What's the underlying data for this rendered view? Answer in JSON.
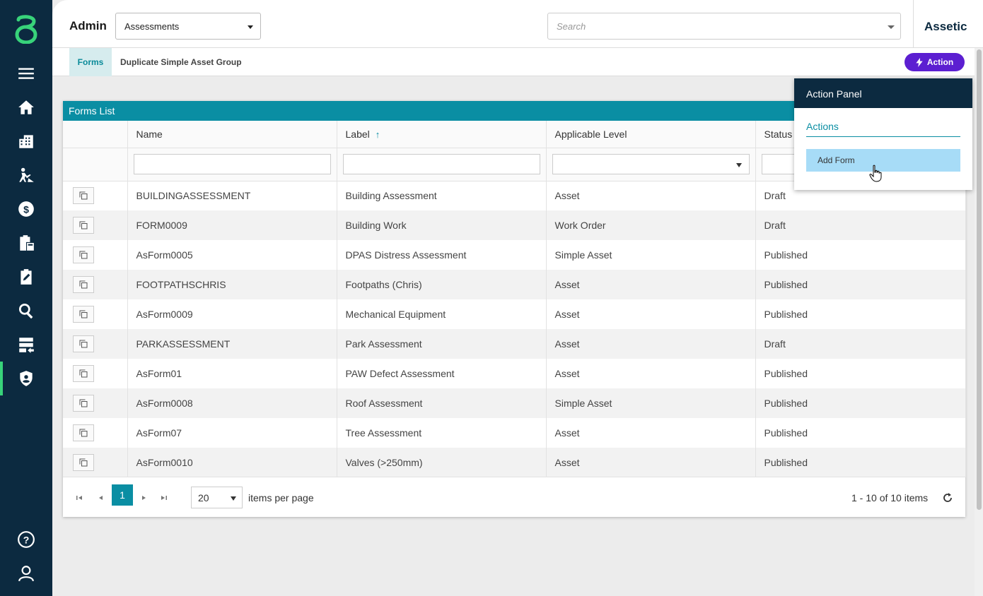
{
  "header": {
    "app_title": "Admin",
    "module_select": "Assessments",
    "search_placeholder": "Search",
    "brand": "Assetic"
  },
  "subbar": {
    "tab_forms": "Forms",
    "crumb": "Duplicate Simple Asset Group",
    "action_label": "Action"
  },
  "sidebar": {
    "icons": [
      "logo-icon",
      "menu-icon",
      "home-icon",
      "buildings-icon",
      "worker-icon",
      "finance-icon",
      "clipboard-calculator-icon",
      "assessment-edit-icon",
      "search-icon",
      "data-import-icon",
      "admin-shield-icon",
      "help-icon",
      "user-icon"
    ],
    "active": "admin-shield-icon",
    "accent": "#38d37a"
  },
  "grid": {
    "title": "Forms List",
    "columns": [
      "Name",
      "Label",
      "Applicable Level",
      "Status"
    ],
    "sorted_column": "Label",
    "rows": [
      {
        "name": "BUILDINGASSESSMENT",
        "label": "Building Assessment",
        "level": "Asset",
        "status": "Draft"
      },
      {
        "name": "FORM0009",
        "label": "Building Work",
        "level": "Work Order",
        "status": "Draft"
      },
      {
        "name": "AsForm0005",
        "label": "DPAS Distress Assessment",
        "level": "Simple Asset",
        "status": "Published"
      },
      {
        "name": "FOOTPATHSCHRIS",
        "label": "Footpaths (Chris)",
        "level": "Asset",
        "status": "Published"
      },
      {
        "name": "AsForm0009",
        "label": "Mechanical Equipment",
        "level": "Asset",
        "status": "Published"
      },
      {
        "name": "PARKASSESSMENT",
        "label": "Park Assessment",
        "level": "Asset",
        "status": "Draft"
      },
      {
        "name": "AsForm01",
        "label": "PAW Defect Assessment",
        "level": "Asset",
        "status": "Published"
      },
      {
        "name": "AsForm0008",
        "label": "Roof Assessment",
        "level": "Simple Asset",
        "status": "Published"
      },
      {
        "name": "AsForm07",
        "label": "Tree Assessment",
        "level": "Asset",
        "status": "Published"
      },
      {
        "name": "AsForm0010",
        "label": "Valves (>250mm)",
        "level": "Asset",
        "status": "Published"
      }
    ],
    "pager": {
      "current_page": "1",
      "page_size": "20",
      "items_per_page_label": "items per page",
      "info": "1 - 10 of 10 items"
    }
  },
  "action_panel": {
    "title": "Action Panel",
    "section": "Actions",
    "item": "Add Form"
  },
  "colors": {
    "sidebar_bg": "#0c2a40",
    "teal": "#0a8ea3",
    "action_purple": "#5c1fd1",
    "highlight": "#a7dcf7"
  }
}
